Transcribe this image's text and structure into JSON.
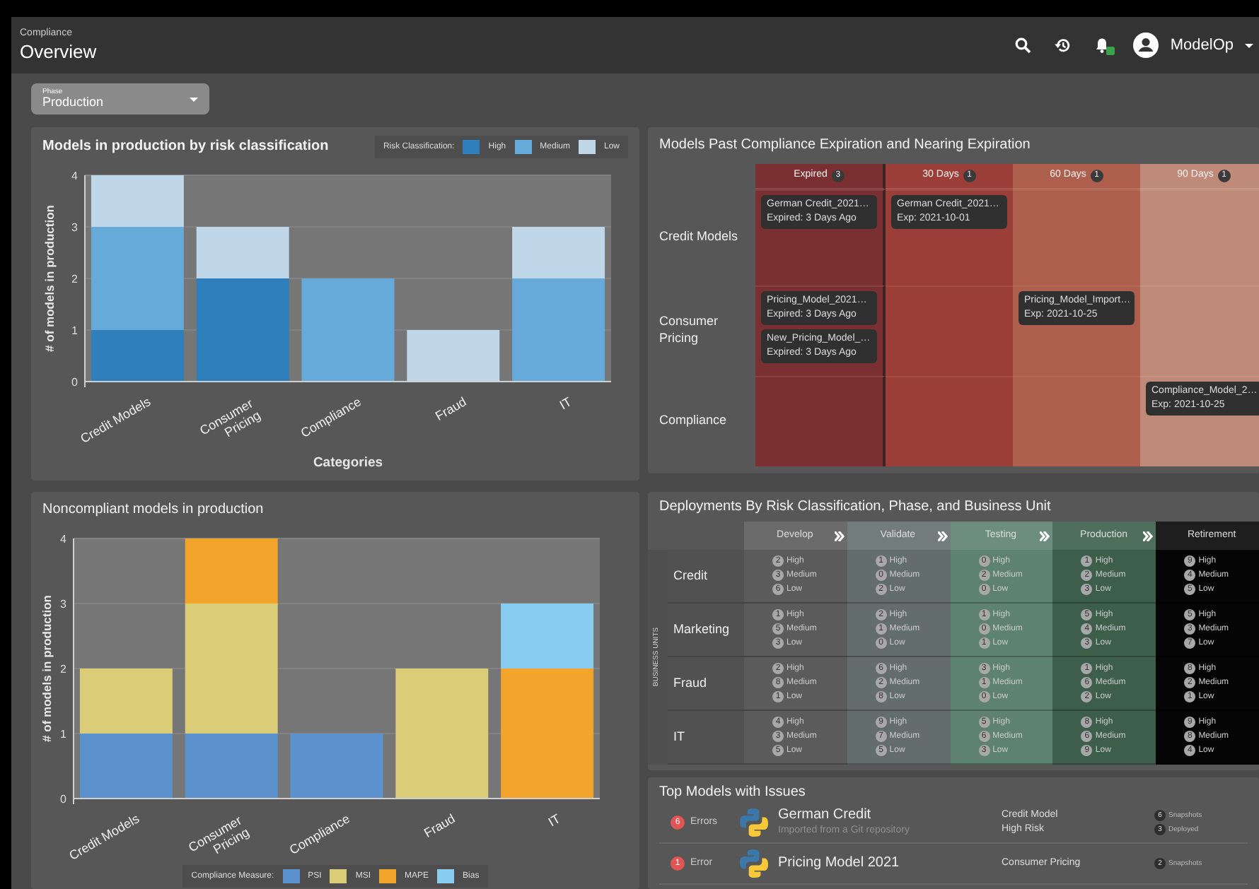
{
  "header": {
    "breadcrumb": "Compliance",
    "title": "Overview",
    "notification_badge": true,
    "user": "ModelOp"
  },
  "filter": {
    "label": "Phase",
    "value": "Production"
  },
  "risk_chart": {
    "title": "Models in production by risk classification",
    "legend_title": "Risk Classification:",
    "chart_data": {
      "type": "bar",
      "stacked": true,
      "grid": true,
      "xlabel": "Categories",
      "ylabel": "# of models in production",
      "categories": [
        "Credit Models",
        "Consumer Pricing",
        "Compliance",
        "Fraud",
        "IT"
      ],
      "ylim": [
        0,
        4
      ],
      "yticks": [
        0,
        1,
        2,
        3,
        4
      ],
      "series": [
        {
          "name": "High",
          "color": "#2f7fbc",
          "values": [
            1,
            2,
            0,
            0,
            0
          ]
        },
        {
          "name": "Medium",
          "color": "#65aad9",
          "values": [
            2,
            0,
            2,
            0,
            2
          ]
        },
        {
          "name": "Low",
          "color": "#c0d6e9",
          "values": [
            1,
            1,
            0,
            1,
            1
          ]
        }
      ]
    }
  },
  "noncompliant_chart": {
    "title": "Noncompliant models in production",
    "legend_title": "Compliance Measure:",
    "chart_data": {
      "type": "bar",
      "stacked": true,
      "grid": true,
      "ylabel": "# of models in production",
      "categories": [
        "Credit Models",
        "Consumer Pricing",
        "Compliance",
        "Fraud",
        "IT"
      ],
      "ylim": [
        0,
        4
      ],
      "yticks": [
        0,
        1,
        2,
        3,
        4
      ],
      "series": [
        {
          "name": "PSI",
          "color": "#5b91cd",
          "values": [
            1,
            1,
            1,
            0,
            0
          ]
        },
        {
          "name": "MSI",
          "color": "#dbcc78",
          "values": [
            1,
            2,
            0,
            2,
            0
          ]
        },
        {
          "name": "MAPE",
          "color": "#f3a52b",
          "values": [
            0,
            1,
            0,
            0,
            2
          ]
        },
        {
          "name": "Bias",
          "color": "#88cdf0",
          "values": [
            0,
            0,
            0,
            0,
            1
          ]
        }
      ]
    }
  },
  "expiration": {
    "title": "Models Past Compliance Expiration and Nearing Expiration",
    "columns": [
      {
        "label": "Expired",
        "count": "3",
        "color": "#7a2f30"
      },
      {
        "label": "30 Days",
        "count": "1",
        "color": "#9b3e38"
      },
      {
        "label": "60 Days",
        "count": "1",
        "color": "#ad5e4c"
      },
      {
        "label": "90 Days",
        "count": "1",
        "color": "#c08a78"
      }
    ],
    "rows": [
      {
        "label": "Credit Models",
        "cells": [
          [
            {
              "name": "German Credit_2021…",
              "detail": "Expired: 3 Days Ago"
            }
          ],
          [
            {
              "name": "German Credit_2021…",
              "detail": "Exp: 2021-10-01"
            }
          ],
          [],
          []
        ]
      },
      {
        "label": "Consumer Pricing",
        "cells": [
          [
            {
              "name": "Pricing_Model_2021…",
              "detail": "Expired: 3 Days Ago"
            },
            {
              "name": "New_Pricing_Model_…",
              "detail": "Expired: 3 Days Ago"
            }
          ],
          [],
          [
            {
              "name": "Pricing_Model_Import…",
              "detail": "Exp: 2021-10-25"
            }
          ],
          []
        ]
      },
      {
        "label": "Compliance",
        "cells": [
          [],
          [],
          [],
          [
            {
              "name": "Compliance_Model_2…",
              "detail": "Exp: 2021-10-25"
            }
          ]
        ]
      }
    ]
  },
  "deployments": {
    "title": "Deployments By Risk Classification, Phase, and Business Unit",
    "side_label": "BUSINESS UNITS",
    "phases": [
      {
        "label": "Develop",
        "color": "#5b5b5b"
      },
      {
        "label": "Validate",
        "color": "#636e6c"
      },
      {
        "label": "Testing",
        "color": "#5d8173"
      },
      {
        "label": "Production",
        "color": "#3c5e4a"
      },
      {
        "label": "Retirement",
        "color": "#050505"
      }
    ],
    "units": [
      {
        "label": "Credit",
        "cells": [
          [
            {
              "count": "2",
              "label": "High"
            },
            {
              "count": "3",
              "label": "Medium"
            },
            {
              "count": "6",
              "label": "Low"
            }
          ],
          [
            {
              "count": "1",
              "label": "High"
            },
            {
              "count": "0",
              "label": "Medium"
            },
            {
              "count": "2",
              "label": "Low"
            }
          ],
          [
            {
              "count": "0",
              "label": "High"
            },
            {
              "count": "2",
              "label": "Medium"
            },
            {
              "count": "0",
              "label": "Low"
            }
          ],
          [
            {
              "count": "1",
              "label": "High"
            },
            {
              "count": "2",
              "label": "Medium"
            },
            {
              "count": "3",
              "label": "Low"
            }
          ],
          [
            {
              "count": "9",
              "label": "High"
            },
            {
              "count": "4",
              "label": "Medium"
            },
            {
              "count": "5",
              "label": "Low"
            }
          ]
        ]
      },
      {
        "label": "Marketing",
        "cells": [
          [
            {
              "count": "1",
              "label": "High"
            },
            {
              "count": "5",
              "label": "Medium"
            },
            {
              "count": "3",
              "label": "Low"
            }
          ],
          [
            {
              "count": "2",
              "label": "High"
            },
            {
              "count": "1",
              "label": "Medium"
            },
            {
              "count": "0",
              "label": "Low"
            }
          ],
          [
            {
              "count": "1",
              "label": "High"
            },
            {
              "count": "0",
              "label": "Medium"
            },
            {
              "count": "1",
              "label": "Low"
            }
          ],
          [
            {
              "count": "5",
              "label": "High"
            },
            {
              "count": "4",
              "label": "Medium"
            },
            {
              "count": "3",
              "label": "Low"
            }
          ],
          [
            {
              "count": "5",
              "label": "High"
            },
            {
              "count": "3",
              "label": "Medium"
            },
            {
              "count": "7",
              "label": "Low"
            }
          ]
        ]
      },
      {
        "label": "Fraud",
        "cells": [
          [
            {
              "count": "2",
              "label": "High"
            },
            {
              "count": "8",
              "label": "Medium"
            },
            {
              "count": "1",
              "label": "Low"
            }
          ],
          [
            {
              "count": "6",
              "label": "High"
            },
            {
              "count": "2",
              "label": "Medium"
            },
            {
              "count": "8",
              "label": "Low"
            }
          ],
          [
            {
              "count": "3",
              "label": "High"
            },
            {
              "count": "1",
              "label": "Medium"
            },
            {
              "count": "0",
              "label": "Low"
            }
          ],
          [
            {
              "count": "1",
              "label": "High"
            },
            {
              "count": "6",
              "label": "Medium"
            },
            {
              "count": "2",
              "label": "Low"
            }
          ],
          [
            {
              "count": "8",
              "label": "High"
            },
            {
              "count": "2",
              "label": "Medium"
            },
            {
              "count": "1",
              "label": "Low"
            }
          ]
        ]
      },
      {
        "label": "IT",
        "cells": [
          [
            {
              "count": "4",
              "label": "High"
            },
            {
              "count": "3",
              "label": "Medium"
            },
            {
              "count": "5",
              "label": "Low"
            }
          ],
          [
            {
              "count": "9",
              "label": "High"
            },
            {
              "count": "7",
              "label": "Medium"
            },
            {
              "count": "5",
              "label": "Low"
            }
          ],
          [
            {
              "count": "5",
              "label": "High"
            },
            {
              "count": "6",
              "label": "Medium"
            },
            {
              "count": "3",
              "label": "Low"
            }
          ],
          [
            {
              "count": "8",
              "label": "High"
            },
            {
              "count": "6",
              "label": "Medium"
            },
            {
              "count": "9",
              "label": "Low"
            }
          ],
          [
            {
              "count": "9",
              "label": "High"
            },
            {
              "count": "8",
              "label": "Medium"
            },
            {
              "count": "4",
              "label": "Low"
            }
          ]
        ]
      }
    ]
  },
  "top_models": {
    "title": "Top Models with Issues",
    "items": [
      {
        "issue_count": "6",
        "issue_label": "Errors",
        "name": "German Credit",
        "source": "Imported from a Git repository",
        "category": "Credit Model",
        "risk": "High Risk",
        "stats": [
          {
            "count": "6",
            "label": "Snapshots"
          },
          {
            "count": "3",
            "label": "Deployed"
          }
        ]
      },
      {
        "issue_count": "1",
        "issue_label": "Error",
        "name": "Pricing Model 2021",
        "category": "Consumer Pricing",
        "stats": [
          {
            "count": "2",
            "label": "Snapshots"
          }
        ]
      }
    ]
  }
}
